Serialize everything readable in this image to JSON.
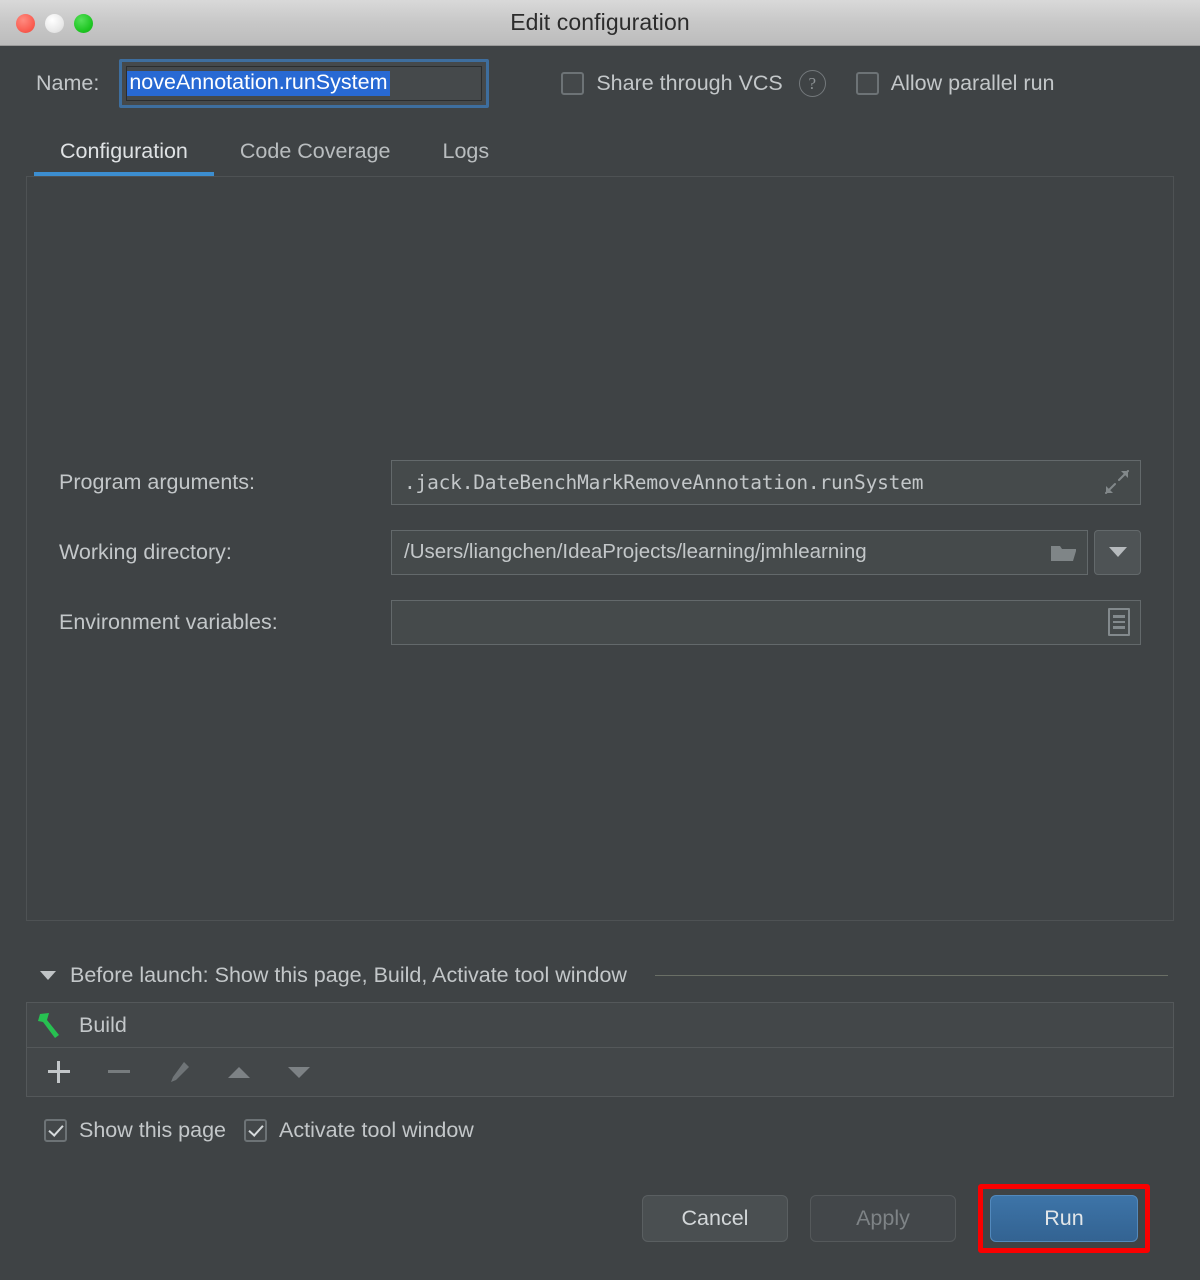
{
  "window": {
    "title": "Edit configuration",
    "controls": [
      {
        "name": "close",
        "icon": "close-dot"
      },
      {
        "name": "minimize",
        "icon": "minimize-dot"
      },
      {
        "name": "maximize",
        "icon": "maximize-dot"
      }
    ]
  },
  "name_row": {
    "label": "Name:",
    "value": "noveAnnotation.runSystem",
    "selected": true
  },
  "options": {
    "share_vcs": {
      "label": "Share through VCS",
      "checked": false
    },
    "help_glyph": "?",
    "allow_parallel": {
      "label": "Allow parallel run",
      "checked": false
    }
  },
  "tabs": [
    {
      "label": "Configuration",
      "active": true
    },
    {
      "label": "Code Coverage",
      "active": false
    },
    {
      "label": "Logs",
      "active": false
    }
  ],
  "form": {
    "program_arguments": {
      "label": "Program arguments:",
      "value": ".jack.DateBenchMarkRemoveAnnotation.runSystem",
      "expand_icon": "expand-arrows-icon"
    },
    "working_directory": {
      "label": "Working directory:",
      "value": "/Users/liangchen/IdeaProjects/learning/jmhlearning",
      "browse_icon": "folder-icon",
      "dropdown_icon": "chevron-down-icon"
    },
    "environment_variables": {
      "label": "Environment variables:",
      "value": "",
      "editor_icon": "list-editor-icon"
    }
  },
  "before_launch": {
    "title": "Before launch: Show this page, Build, Activate tool window",
    "collapse_icon": "caret-down-icon",
    "items": [
      {
        "label": "Build",
        "icon": "hammer-icon"
      }
    ],
    "toolbar": [
      {
        "name": "add",
        "icon": "plus-icon",
        "enabled": true
      },
      {
        "name": "remove",
        "icon": "minus-icon",
        "enabled": false
      },
      {
        "name": "edit",
        "icon": "pencil-icon",
        "enabled": false
      },
      {
        "name": "move-up",
        "icon": "triangle-up-icon",
        "enabled": false
      },
      {
        "name": "move-down",
        "icon": "triangle-down-icon",
        "enabled": false
      }
    ],
    "checkboxes": [
      {
        "label": "Show this page",
        "checked": true
      },
      {
        "label": "Activate tool window",
        "checked": true
      }
    ]
  },
  "footer": {
    "cancel": "Cancel",
    "apply": "Apply",
    "run": "Run",
    "run_highlighted": true
  },
  "colors": {
    "accent_blue": "#3c8ed0",
    "selection_blue": "#2869d3",
    "primary_button": "#3d74a8",
    "highlight_red": "#fa0000",
    "build_green": "#27c151",
    "dialog_bg": "#3f4345",
    "titlebar_bg": "#c8c8c8",
    "text": "#c3c7c9"
  }
}
